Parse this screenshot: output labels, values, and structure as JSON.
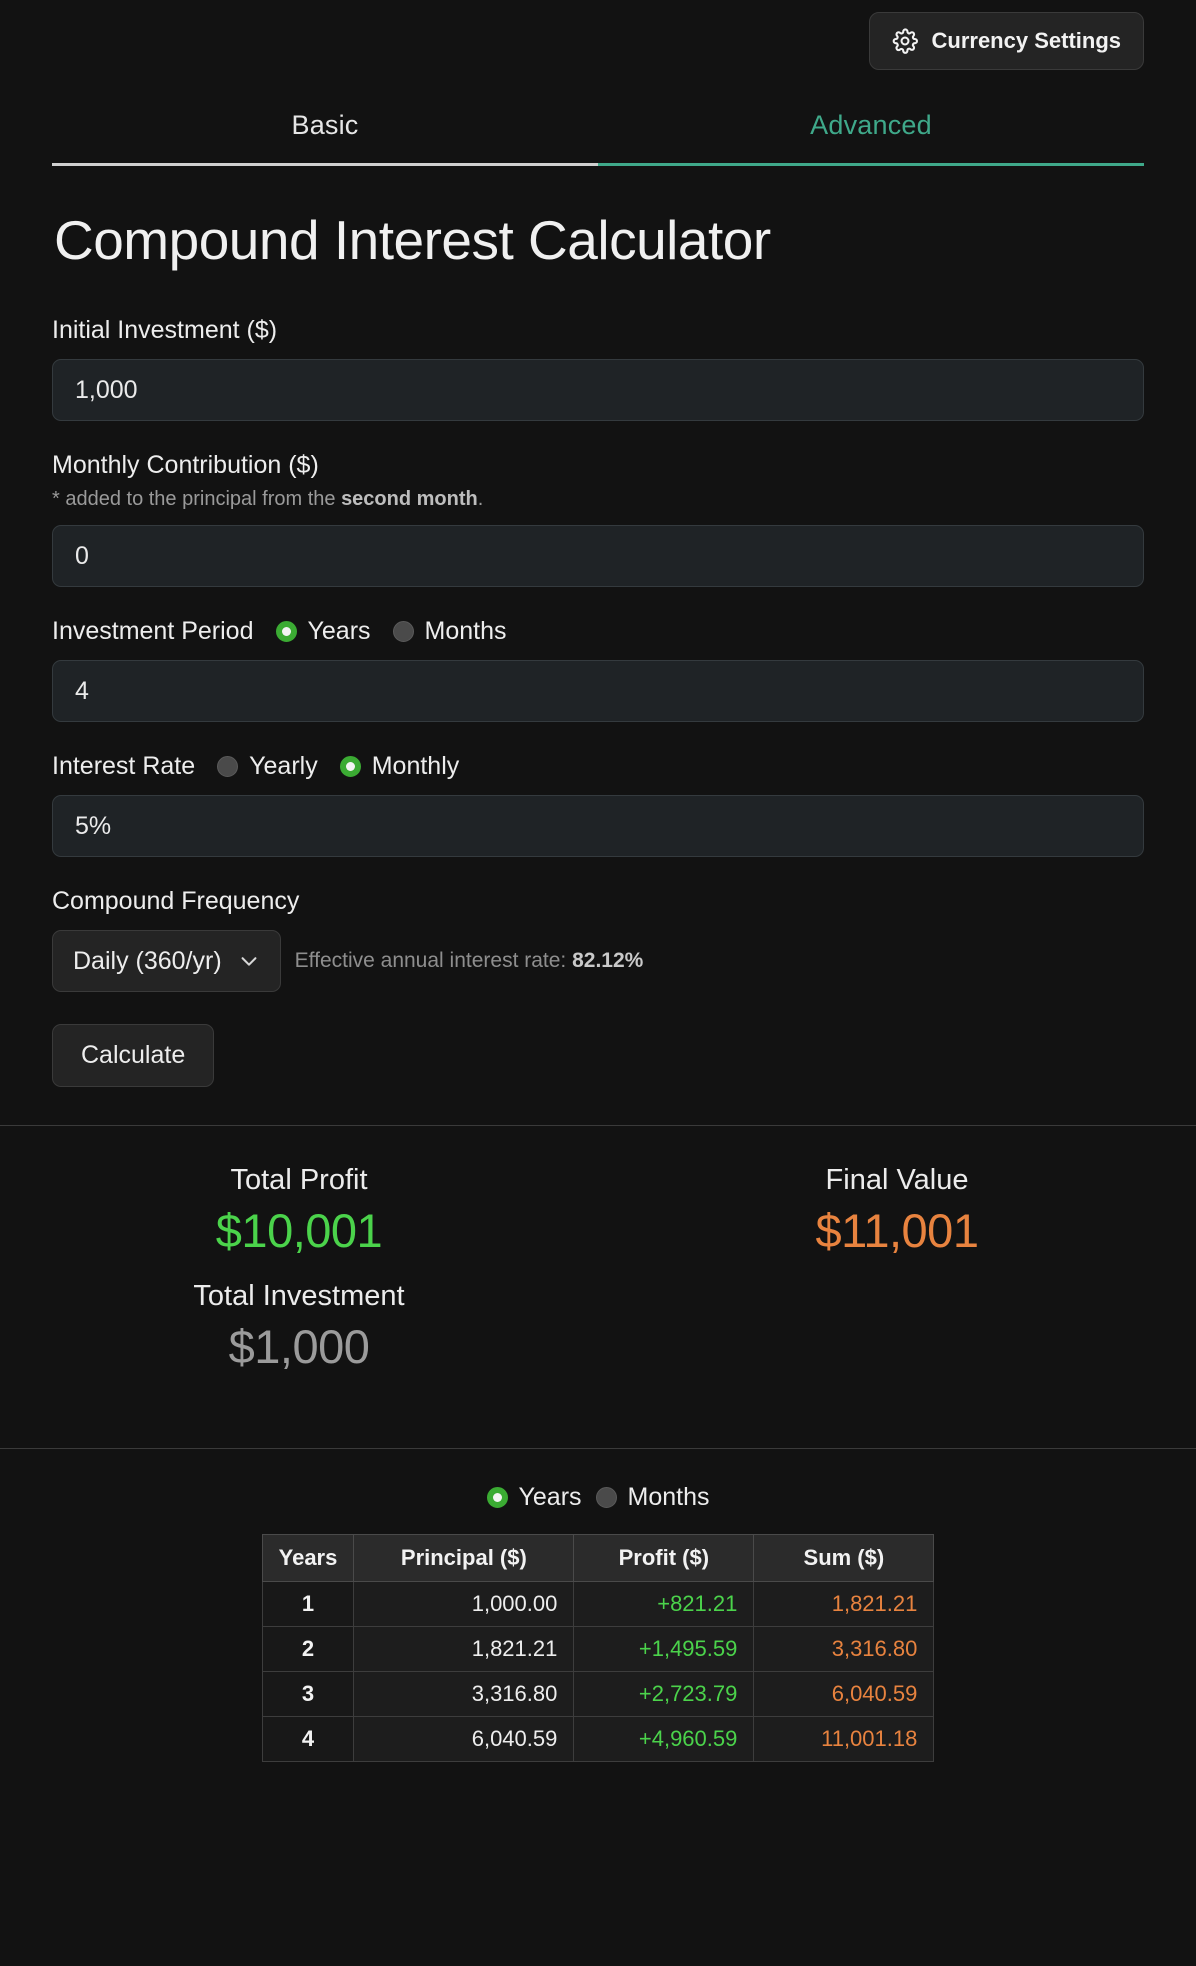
{
  "topbar": {
    "currency_settings_label": "Currency Settings",
    "gear_icon": "gear-icon"
  },
  "tabs": [
    {
      "label": "Basic",
      "active": true
    },
    {
      "label": "Advanced",
      "accent": true
    }
  ],
  "page_title": "Compound Interest Calculator",
  "form": {
    "initial_investment": {
      "label": "Initial Investment ($)",
      "value": "1,000"
    },
    "monthly_contribution": {
      "label": "Monthly Contribution ($)",
      "note_prefix": "* added to the principal from the ",
      "note_bold": "second month",
      "note_suffix": ".",
      "value": "0"
    },
    "investment_period": {
      "label": "Investment Period",
      "option_years": "Years",
      "option_months": "Months",
      "selected": "Years",
      "value": "4"
    },
    "interest_rate": {
      "label": "Interest Rate",
      "option_yearly": "Yearly",
      "option_monthly": "Monthly",
      "selected": "Monthly",
      "value": "5%"
    },
    "compound_frequency": {
      "label": "Compound Frequency",
      "selected_option": "Daily (360/yr)",
      "effective_rate_prefix": "Effective annual interest rate: ",
      "effective_rate_value": "82.12%"
    },
    "calculate_label": "Calculate"
  },
  "results": {
    "total_profit_label": "Total Profit",
    "total_profit_value": "$10,001",
    "final_value_label": "Final Value",
    "final_value_value": "$11,001",
    "total_investment_label": "Total Investment",
    "total_investment_value": "$1,000"
  },
  "schedule": {
    "toggle_years": "Years",
    "toggle_months": "Months",
    "toggle_selected": "Years",
    "headers": [
      "Years",
      "Principal ($)",
      "Profit ($)",
      "Sum ($)"
    ],
    "rows": [
      {
        "year": "1",
        "principal": "1,000.00",
        "profit": "+821.21",
        "sum": "1,821.21"
      },
      {
        "year": "2",
        "principal": "1,821.21",
        "profit": "+1,495.59",
        "sum": "3,316.80"
      },
      {
        "year": "3",
        "principal": "3,316.80",
        "profit": "+2,723.79",
        "sum": "6,040.59"
      },
      {
        "year": "4",
        "principal": "6,040.59",
        "profit": "+4,960.59",
        "sum": "11,001.18"
      }
    ]
  },
  "colors": {
    "background": "#121212",
    "accent_teal": "#3fa98a",
    "profit_green": "#4bd34b",
    "sum_orange": "#e8833f",
    "muted_gray": "#9b9b9b",
    "radio_green": "#3bab33"
  }
}
